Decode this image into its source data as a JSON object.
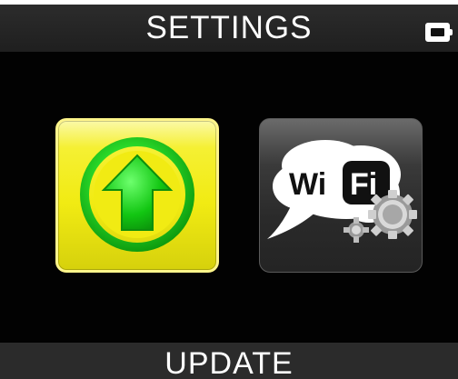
{
  "header": {
    "title": "SETTINGS",
    "battery_icon": "battery-icon"
  },
  "tiles": [
    {
      "name": "update",
      "icon": "upload-arrow-icon",
      "state": "selected",
      "accent": "#f1eb13"
    },
    {
      "name": "wifi",
      "icon": "wifi-settings-icon",
      "icon_text_wi": "Wi",
      "icon_text_fi": "Fi"
    }
  ],
  "footer": {
    "label": "UPDATE"
  },
  "colors": {
    "background": "#020202",
    "header": "#2b2b2b",
    "arrow_green": "#17b617",
    "selected_yellow": "#f1eb13"
  }
}
